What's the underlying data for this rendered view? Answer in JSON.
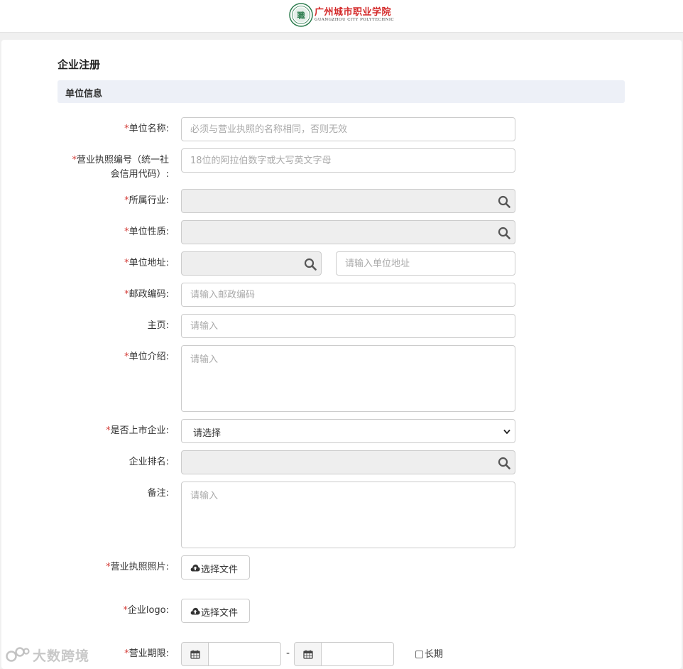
{
  "header": {
    "logo_cn": "广州城市职业学院",
    "logo_en": "GUANGZHOU CITY POLYTECHNIC",
    "emblem_char": "職"
  },
  "page_title": "企业注册",
  "section_title": "单位信息",
  "required_mark": "*",
  "fields": {
    "unit_name": {
      "label": "单位名称:",
      "placeholder": "必须与营业执照的名称相同，否则无效"
    },
    "license_no": {
      "label_line1": "营业执照编号（统一社",
      "label_line2": "会信用代码）:",
      "placeholder": "18位的阿拉伯数字或大写英文字母"
    },
    "industry": {
      "label": "所属行业:"
    },
    "nature": {
      "label": "单位性质:"
    },
    "address": {
      "label": "单位地址:",
      "placeholder": "请输入单位地址"
    },
    "postcode": {
      "label": "邮政编码:",
      "placeholder": "请输入邮政编码"
    },
    "homepage": {
      "label": "主页:",
      "placeholder": "请输入"
    },
    "intro": {
      "label": "单位介绍:",
      "placeholder": "请输入"
    },
    "listed": {
      "label": "是否上市企业:",
      "selected": "请选择"
    },
    "ranking": {
      "label": "企业排名:"
    },
    "remark": {
      "label": "备注:",
      "placeholder": "请输入"
    },
    "license_photo": {
      "label": "营业执照照片:",
      "button": "选择文件"
    },
    "logo": {
      "label": "企业logo:",
      "button": "选择文件"
    },
    "term": {
      "label": "营业期限:",
      "separator": "-",
      "long_term": "长期"
    }
  },
  "watermark": {
    "text": "大数跨境"
  },
  "colors": {
    "required": "#d43f3a",
    "logo_red": "#d42a2a",
    "emblem_green": "#2e7d4f",
    "section_bg": "#edf0f7",
    "readonly_bg": "#eeeeee"
  }
}
